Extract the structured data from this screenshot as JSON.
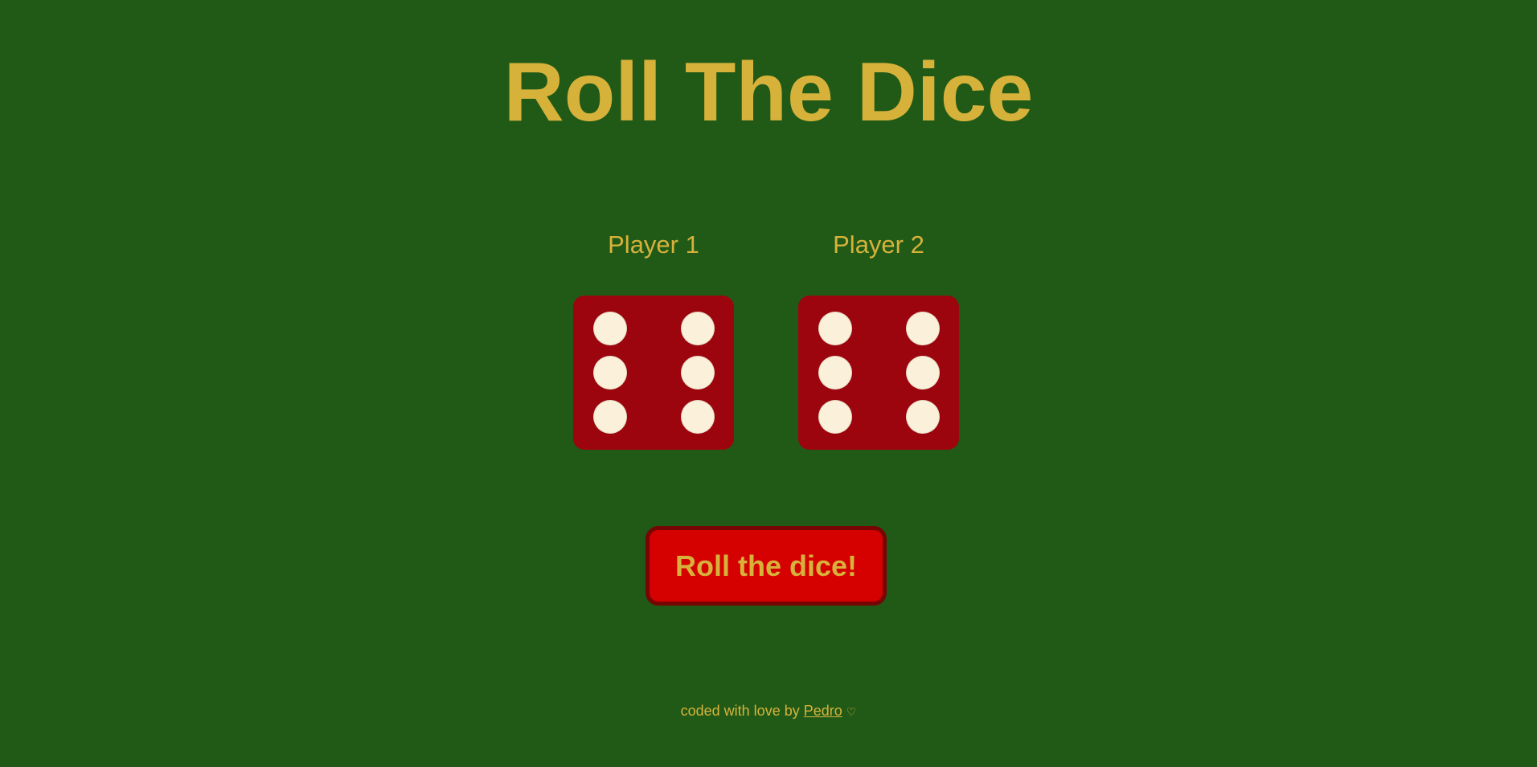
{
  "title": "Roll The Dice",
  "players": [
    {
      "label": "Player 1",
      "die_value": 6
    },
    {
      "label": "Player 2",
      "die_value": 6
    }
  ],
  "roll_button_label": "Roll the dice!",
  "footer": {
    "prefix": "coded with love by",
    "author": "Pedro",
    "heart": "♡"
  },
  "colors": {
    "background": "#215a17",
    "text_gold": "#d7b23b",
    "die_red": "#9c050e",
    "pip_cream": "#fbf0d9",
    "button_red": "#d50000",
    "button_border": "#760503"
  }
}
